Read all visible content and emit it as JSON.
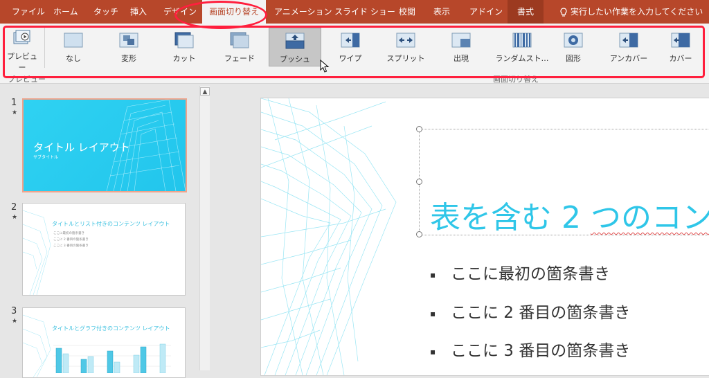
{
  "tabs": [
    {
      "label": "ファイル"
    },
    {
      "label": "ホーム"
    },
    {
      "label": "タッチ"
    },
    {
      "label": "挿入"
    },
    {
      "label": "デザイン"
    },
    {
      "label": "画面切り替え",
      "active": true
    },
    {
      "label": "アニメーション"
    },
    {
      "label": "スライド ショー"
    },
    {
      "label": "校閲"
    },
    {
      "label": "表示"
    },
    {
      "label": "アドイン"
    },
    {
      "label": "書式",
      "contextual": true
    }
  ],
  "tell_me": "実行したい作業を入力してください",
  "ribbon": {
    "preview_label": "プレビュー",
    "preview_group_label": "プレビュー",
    "transitions_group_label": "画面切り替え",
    "gallery": [
      {
        "label": "なし",
        "icon": "none-transition-icon"
      },
      {
        "label": "変形",
        "icon": "morph-transition-icon"
      },
      {
        "label": "カット",
        "icon": "cut-transition-icon"
      },
      {
        "label": "フェード",
        "icon": "fade-transition-icon"
      },
      {
        "label": "プッシュ",
        "icon": "push-transition-icon",
        "selected": true
      },
      {
        "label": "ワイプ",
        "icon": "wipe-transition-icon"
      },
      {
        "label": "スプリット",
        "icon": "split-transition-icon"
      },
      {
        "label": "出現",
        "icon": "reveal-transition-icon"
      },
      {
        "label": "ランダムスト…",
        "icon": "random-bars-transition-icon"
      },
      {
        "label": "図形",
        "icon": "shape-transition-icon"
      },
      {
        "label": "アンカバー",
        "icon": "uncover-transition-icon"
      },
      {
        "label": "カバー",
        "icon": "cover-transition-icon"
      }
    ]
  },
  "thumbnails": [
    {
      "number": "1",
      "star": "★",
      "title": "タイトル レイアウト",
      "subtitle": "サブタイトル"
    },
    {
      "number": "2",
      "star": "★",
      "title": "タイトルとリスト付きのコンテンツ レイアウト",
      "bullets": [
        "ここに最初の箇条書き",
        "ここに 2 番目の箇条書き",
        "ここに 3 番目の箇条書き"
      ]
    },
    {
      "number": "3",
      "star": "★",
      "title": "タイトルとグラフ付きのコンテンツ レイアウト"
    }
  ],
  "slide": {
    "title_a": "表を含む 2 ",
    "title_b": "つのコンテ",
    "bullets": [
      "ここに最初の箇条書き",
      "ここに 2 番目の箇条書き",
      "ここに 3 番目の箇条書き"
    ],
    "bullet_marker": "▪"
  },
  "colors": {
    "tab_bar": "#b7472a",
    "accent_text": "#2fc6e8",
    "highlight": "#ff1f3d"
  }
}
